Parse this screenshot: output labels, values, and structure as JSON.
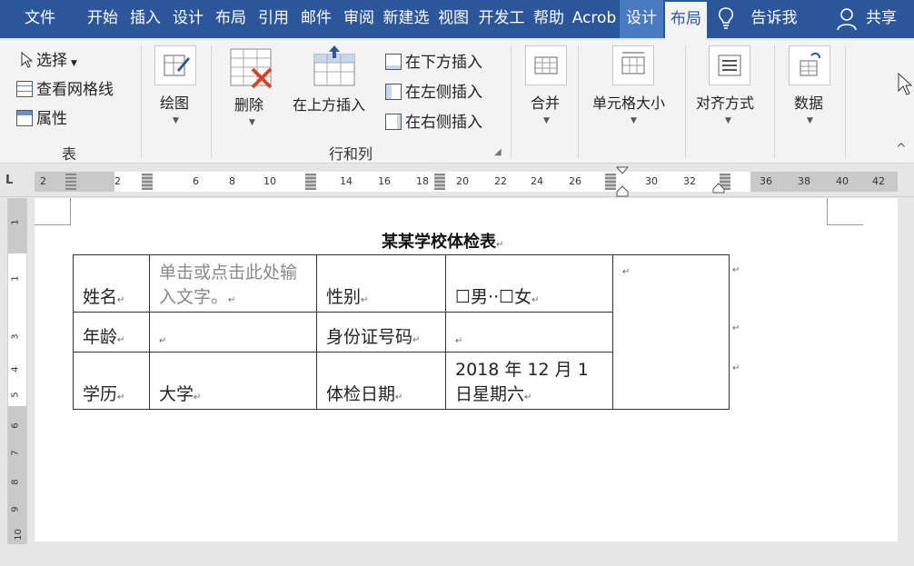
{
  "tabs": [
    {
      "label": "文件"
    },
    {
      "label": "开始"
    },
    {
      "label": "插入"
    },
    {
      "label": "设计"
    },
    {
      "label": "布局"
    },
    {
      "label": "引用"
    },
    {
      "label": "邮件"
    },
    {
      "label": "审阅"
    },
    {
      "label": "新建选"
    },
    {
      "label": "视图"
    },
    {
      "label": "开发工"
    },
    {
      "label": "帮助"
    },
    {
      "label": "Acrob"
    },
    {
      "label": "设计"
    },
    {
      "label": "布局"
    }
  ],
  "tell_me": "告诉我",
  "share": "共享",
  "ribbon": {
    "table_group": {
      "select": "选择",
      "gridlines": "查看网格线",
      "properties": "属性",
      "label": "表"
    },
    "draw": "绘图",
    "delete": "删除",
    "insert_above": "在上方插入",
    "insert_below": "在下方插入",
    "insert_left": "在左侧插入",
    "insert_right": "在右侧插入",
    "rows_cols_label": "行和列",
    "merge": "合并",
    "cell_size": "单元格大小",
    "alignment": "对齐方式",
    "data": "数据"
  },
  "ruler": {
    "h_numbers": [
      "2",
      "2",
      "6",
      "8",
      "10",
      "14",
      "16",
      "18",
      "20",
      "22",
      "24",
      "26",
      "30",
      "32",
      "36",
      "38",
      "40",
      "42"
    ],
    "v_numbers": [
      "1",
      "1",
      "3",
      "4",
      "5",
      "6",
      "7",
      "8",
      "9",
      "10"
    ]
  },
  "document": {
    "title": "某某学校体检表",
    "rows": [
      {
        "c1": "姓名",
        "c2": "单击或点击此处输入文字。",
        "c3": "性别",
        "c4": "☐男··☐女"
      },
      {
        "c1": "年龄",
        "c2": "",
        "c3": "身份证号码",
        "c4": ""
      },
      {
        "c1": "学历",
        "c2": "大学",
        "c3": "体检日期",
        "c4": "2018 年 12 月 1 日星期六"
      }
    ]
  },
  "colors": {
    "accent": "#2b579a",
    "ribbon_bg": "#f3f3f3"
  }
}
